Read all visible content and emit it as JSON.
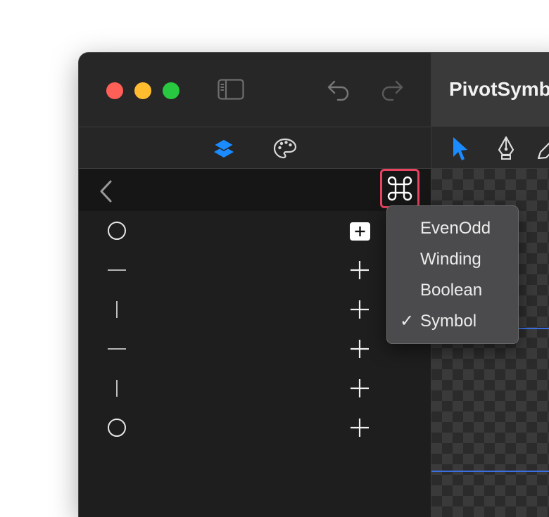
{
  "window": {
    "document_title": "PivotSymb"
  },
  "toolbar": {
    "sidebar_toggle_icon": "sidebar-icon",
    "undo_icon": "undo-icon",
    "redo_icon": "redo-icon"
  },
  "tabs": [
    {
      "name": "layers",
      "icon": "layers-icon",
      "active": true,
      "color": "#1a8cff"
    },
    {
      "name": "styles",
      "icon": "palette-icon",
      "active": false
    }
  ],
  "nav": {
    "back_icon": "chevron-left-icon",
    "command_icon": "command-icon",
    "command_glyph": "⌘"
  },
  "shape_rows": [
    {
      "shape": "circle",
      "action": "plus-filled"
    },
    {
      "shape": "horizontal-line",
      "action": "plus"
    },
    {
      "shape": "vertical-line",
      "action": "plus"
    },
    {
      "shape": "horizontal-line",
      "action": "plus"
    },
    {
      "shape": "vertical-line",
      "action": "plus"
    },
    {
      "shape": "circle",
      "action": "plus"
    }
  ],
  "tools": [
    "pointer-icon",
    "pen-icon",
    "pencil-icon"
  ],
  "menu": {
    "items": [
      {
        "label": "EvenOdd",
        "checked": false
      },
      {
        "label": "Winding",
        "checked": false
      },
      {
        "label": "Boolean",
        "checked": false
      },
      {
        "label": "Symbol",
        "checked": true
      }
    ],
    "check_glyph": "✓"
  },
  "colors": {
    "highlight": "#e8435f",
    "accent": "#1a8cff",
    "guide": "#3b6fe0"
  }
}
